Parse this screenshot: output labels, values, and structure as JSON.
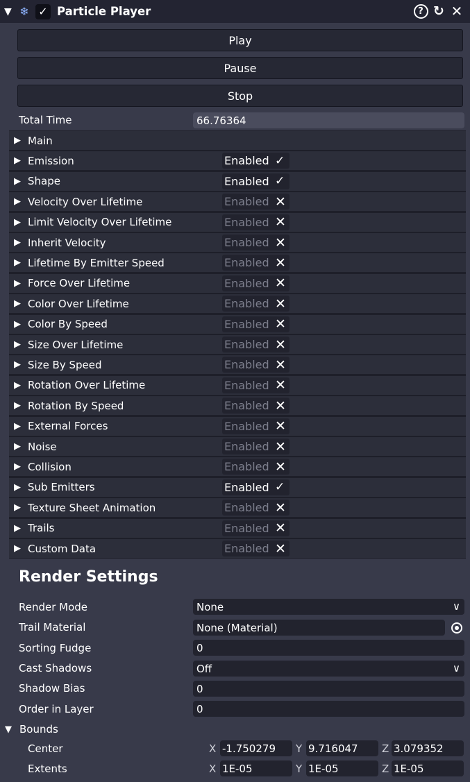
{
  "header": {
    "title": "Particle Player",
    "enabled_mark": "✓",
    "collapse_icon": "▼",
    "component_icon": "❄",
    "help_icon": "?",
    "reset_icon": "↻",
    "close_icon": "✕"
  },
  "controls": {
    "play": "Play",
    "pause": "Pause",
    "stop": "Stop"
  },
  "total_time": {
    "label": "Total Time",
    "value": "66.76364"
  },
  "modules": [
    {
      "name": "Main",
      "toggle": null
    },
    {
      "name": "Emission",
      "toggle": "Enabled",
      "enabled": true
    },
    {
      "name": "Shape",
      "toggle": "Enabled",
      "enabled": true
    },
    {
      "name": "Velocity Over Lifetime",
      "toggle": "Enabled",
      "enabled": false
    },
    {
      "name": "Limit Velocity Over Lifetime",
      "toggle": "Enabled",
      "enabled": false
    },
    {
      "name": "Inherit Velocity",
      "toggle": "Enabled",
      "enabled": false
    },
    {
      "name": "Lifetime By Emitter Speed",
      "toggle": "Enabled",
      "enabled": false
    },
    {
      "name": "Force Over Lifetime",
      "toggle": "Enabled",
      "enabled": false
    },
    {
      "name": "Color Over Lifetime",
      "toggle": "Enabled",
      "enabled": false
    },
    {
      "name": "Color By Speed",
      "toggle": "Enabled",
      "enabled": false
    },
    {
      "name": "Size Over Lifetime",
      "toggle": "Enabled",
      "enabled": false
    },
    {
      "name": "Size By Speed",
      "toggle": "Enabled",
      "enabled": false
    },
    {
      "name": "Rotation Over Lifetime",
      "toggle": "Enabled",
      "enabled": false
    },
    {
      "name": "Rotation By Speed",
      "toggle": "Enabled",
      "enabled": false
    },
    {
      "name": "External Forces",
      "toggle": "Enabled",
      "enabled": false
    },
    {
      "name": "Noise",
      "toggle": "Enabled",
      "enabled": false
    },
    {
      "name": "Collision",
      "toggle": "Enabled",
      "enabled": false
    },
    {
      "name": "Sub Emitters",
      "toggle": "Enabled",
      "enabled": true
    },
    {
      "name": "Texture Sheet Animation",
      "toggle": "Enabled",
      "enabled": false
    },
    {
      "name": "Trails",
      "toggle": "Enabled",
      "enabled": false
    },
    {
      "name": "Custom Data",
      "toggle": "Enabled",
      "enabled": false
    }
  ],
  "marks": {
    "on": "✓",
    "off": "✕",
    "expand": "▶",
    "dropdown": "∨"
  },
  "render": {
    "title": "Render Settings",
    "render_mode": {
      "label": "Render Mode",
      "value": "None"
    },
    "trail_material": {
      "label": "Trail Material",
      "value": "None (Material)"
    },
    "sorting_fudge": {
      "label": "Sorting Fudge",
      "value": "0"
    },
    "cast_shadows": {
      "label": "Cast Shadows",
      "value": "Off"
    },
    "shadow_bias": {
      "label": "Shadow Bias",
      "value": "0"
    },
    "order_in_layer": {
      "label": "Order in Layer",
      "value": "0"
    }
  },
  "bounds": {
    "label": "Bounds",
    "collapse_icon": "▼",
    "center": {
      "label": "Center",
      "x": "-1.750279",
      "y": "9.716047",
      "z": "3.079352"
    },
    "extents": {
      "label": "Extents",
      "x": "1E-05",
      "y": "1E-05",
      "z": "1E-05"
    },
    "axis_x": "X",
    "axis_y": "Y",
    "axis_z": "Z"
  }
}
